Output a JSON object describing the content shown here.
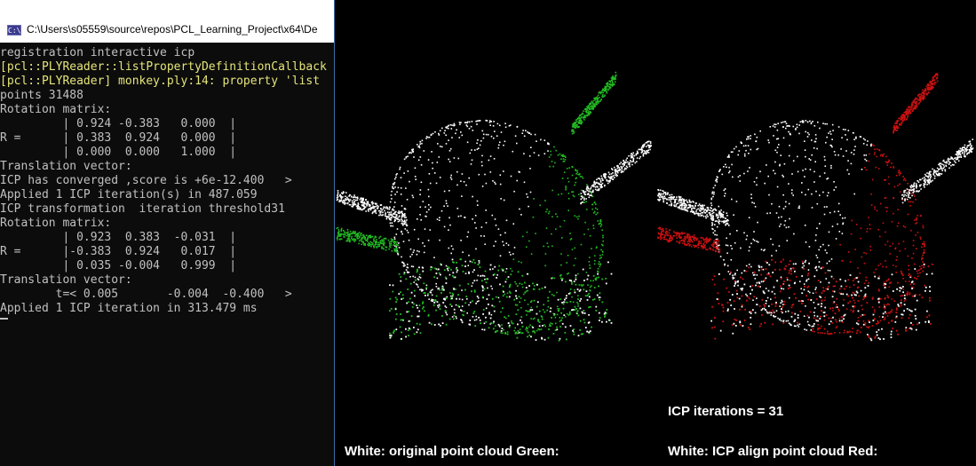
{
  "console": {
    "title": "C:\\Users\\s05559\\source\\repos\\PCL_Learning_Project\\x64\\De",
    "app_icon": "C:\\",
    "lines": [
      {
        "text": "registration interactive icp",
        "color": "default"
      },
      {
        "text": "[pcl::PLYReader::listPropertyDefinitionCallback",
        "color": "yellow"
      },
      {
        "text": "[pcl::PLYReader] monkey.ply:14: property 'list",
        "color": "yellow"
      },
      {
        "text": "points 31488",
        "color": "default"
      },
      {
        "text": "Rotation matrix:",
        "color": "default"
      },
      {
        "text": "         | 0.924 -0.383   0.000  |",
        "color": "default"
      },
      {
        "text": "R =      | 0.383  0.924   0.000  |",
        "color": "default"
      },
      {
        "text": "         | 0.000  0.000   1.000  |",
        "color": "default"
      },
      {
        "text": "Translation vector:",
        "color": "default"
      },
      {
        "text": "ICP has converged ,score is +6e-12.400   >",
        "color": "default"
      },
      {
        "text": "Applied 1 ICP iteration(s) in 487.059",
        "color": "default"
      },
      {
        "text": "ICP transformation  iteration threshold31",
        "color": "default"
      },
      {
        "text": "Rotation matrix:",
        "color": "default"
      },
      {
        "text": "         | 0.923  0.383  -0.031  |",
        "color": "default"
      },
      {
        "text": "R =      |-0.383  0.924   0.017  |",
        "color": "default"
      },
      {
        "text": "         | 0.035 -0.004   0.999  |",
        "color": "default"
      },
      {
        "text": "Translation vector:",
        "color": "default"
      },
      {
        "text": "        t=< 0.005       -0.004  -0.400   >",
        "color": "default"
      },
      {
        "text": "Applied 1 ICP iteration in 313.479 ms",
        "color": "default"
      }
    ]
  },
  "viewer": {
    "left": {
      "caption": "White: original point cloud Green:"
    },
    "right": {
      "iterations": "ICP iterations = 31",
      "caption": "White: ICP align point cloud Red:"
    }
  },
  "colors": {
    "console_bg": "#0c0c0c",
    "console_text": "#c0c0c0",
    "console_highlight": "#e5e57a",
    "viewport_bg": "#000000",
    "cloud_white": "#ffffff",
    "cloud_green": "#22bb22",
    "cloud_red": "#cc1111"
  }
}
